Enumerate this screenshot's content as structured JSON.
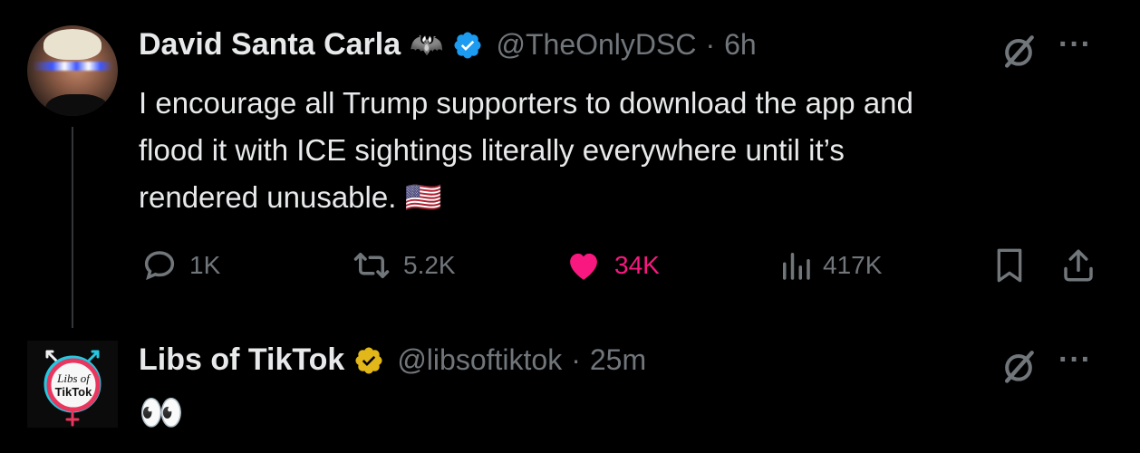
{
  "tweet1": {
    "name": "David Santa Carla",
    "name_emoji": "🦇",
    "handle": "@TheOnlyDSC",
    "separator": "·",
    "time": "6h",
    "text_line1": "I encourage all Trump supporters to download the app and",
    "text_line2": "flood it with ICE sightings literally everywhere until it’s",
    "text_line3": "rendered unusable.",
    "flag_emoji": "🇺🇸",
    "more": "···",
    "actions": {
      "replies": "1K",
      "reposts": "5.2K",
      "likes": "34K",
      "views": "417K"
    }
  },
  "tweet2": {
    "name": "Libs of TikTok",
    "handle": "@libsoftiktok",
    "separator": "·",
    "time": "25m",
    "text": "👀",
    "more": "···",
    "avatar_text_1": "Libs of",
    "avatar_text_2": "TikTok"
  },
  "colors": {
    "verified_blue": "#1d9bf0",
    "verified_gold": "#e2b719",
    "like_pink": "#f91880",
    "muted": "#71767b"
  }
}
